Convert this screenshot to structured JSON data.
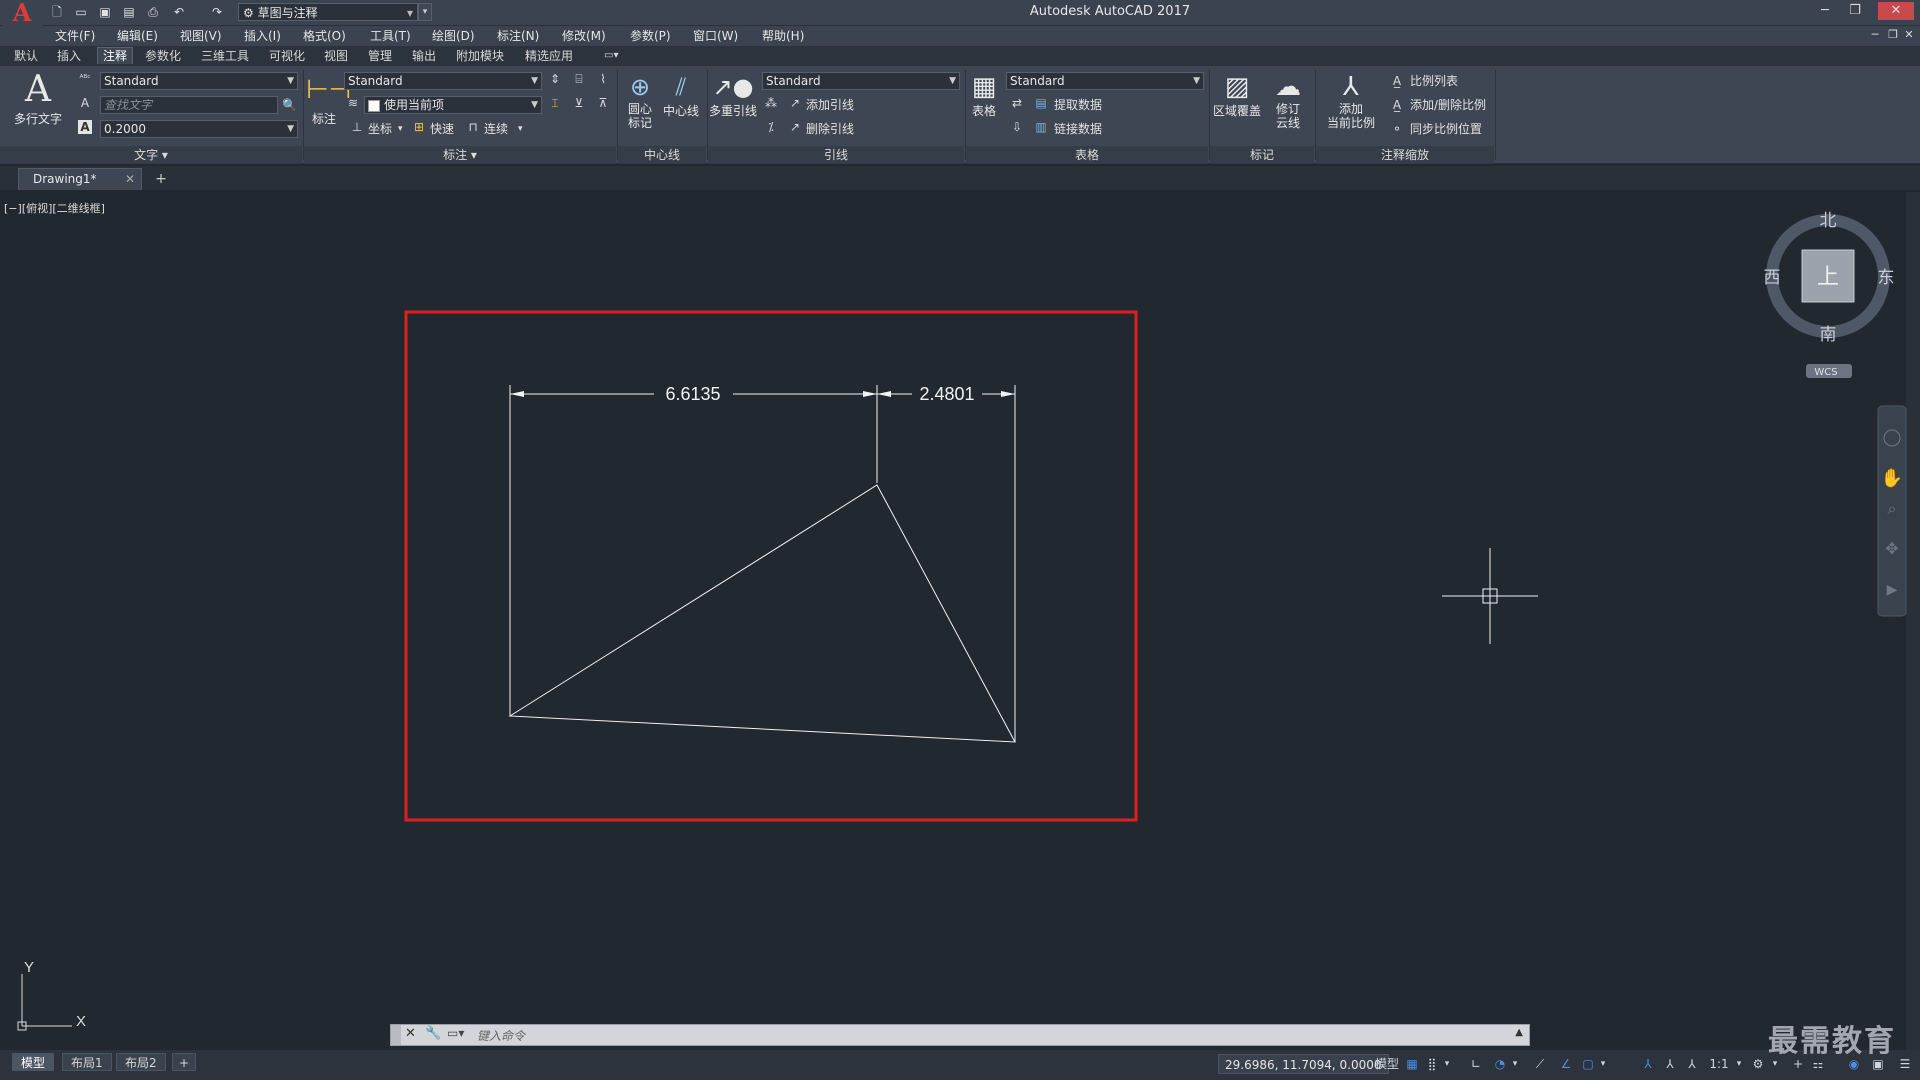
{
  "app_title": "Autodesk AutoCAD 2017",
  "logo": "A",
  "workspace": {
    "name": "草图与注释"
  },
  "menu": [
    "文件(F)",
    "编辑(E)",
    "视图(V)",
    "插入(I)",
    "格式(O)",
    "工具(T)",
    "绘图(D)",
    "标注(N)",
    "修改(M)",
    "参数(P)",
    "窗口(W)",
    "帮助(H)"
  ],
  "ribbon_tabs": [
    "默认",
    "插入",
    "注释",
    "参数化",
    "三维工具",
    "可视化",
    "视图",
    "管理",
    "输出",
    "附加模块",
    "精选应用"
  ],
  "active_tab": "注释",
  "ribbon": {
    "text_panel": {
      "title": "文字",
      "mtext_label": "多行文字",
      "style": "Standard",
      "find_placeholder": "查找文字",
      "height": "0.2000"
    },
    "dim_panel": {
      "title": "标注",
      "dim_label": "标注",
      "style": "Standard",
      "layer": "使用当前项",
      "ordinate": "坐标",
      "quick": "快速",
      "continue": "连续"
    },
    "centerline_panel": {
      "title": "中心线",
      "center_mark": "圆心\n标记",
      "centerline": "中心线"
    },
    "leader_panel": {
      "title": "引线",
      "mleader": "多重引线",
      "style": "Standard",
      "add_leader": "添加引线",
      "remove_leader": "删除引线"
    },
    "table_panel": {
      "title": "表格",
      "table": "表格",
      "style": "Standard",
      "extract": "提取数据",
      "link": "链接数据"
    },
    "markup_panel": {
      "title": "标记",
      "wipeout": "区域覆盖",
      "revcloud": "修订\n云线"
    },
    "scale_panel": {
      "title": "注释缩放",
      "add_scale": "添加\n当前比例",
      "scale_list": "比例列表",
      "add_remove": "添加/删除比例",
      "sync": "同步比例位置"
    }
  },
  "doc_tab": "Drawing1*",
  "view_label": "[−][俯视][二维线框]",
  "drawing": {
    "dim1": "6.6135",
    "dim2": "2.4801",
    "ucs_x": "X",
    "ucs_y": "Y"
  },
  "viewcube": {
    "north": "北",
    "south": "南",
    "east": "东",
    "west": "西",
    "top": "上",
    "wcs": "WCS"
  },
  "command_line": {
    "placeholder": "键入命令"
  },
  "layout_tabs": [
    "模型",
    "布局1",
    "布局2"
  ],
  "status": {
    "coords": "29.6986, 11.7094, 0.0000",
    "mode": "模型",
    "scale": "1:1"
  },
  "watermark": "最需教育",
  "colors": {
    "highlight_box": "#e02020",
    "canvas": "#212830"
  }
}
